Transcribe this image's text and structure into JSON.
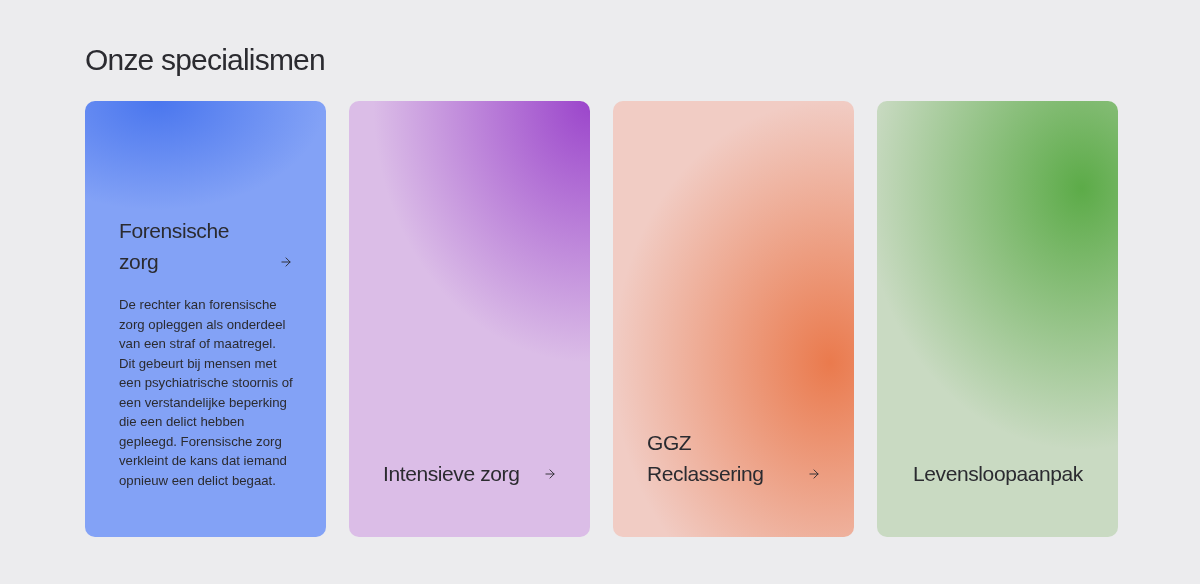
{
  "heading": "Onze specialismen",
  "cards": [
    {
      "title": "Forensische zorg",
      "description": "De rechter kan forensische zorg opleggen als onderdeel van een straf of maatregel. Dit gebeurt bij mensen met een psychiatrische stoornis of een verstandelijke beperking die een delict hebben gepleegd. Forensische zorg verkleint de kans dat iemand opnieuw een delict begaat.",
      "expanded": true,
      "arrow": true,
      "color": "#4a76ee"
    },
    {
      "title": "Intensieve zorg",
      "expanded": false,
      "arrow": true,
      "color": "#9b45cb"
    },
    {
      "title": "GGZ Reclassering",
      "expanded": false,
      "arrow": true,
      "color": "#ea7a4d"
    },
    {
      "title": "Levensloopaanpak",
      "expanded": false,
      "arrow": false,
      "color": "#5cab48"
    }
  ]
}
